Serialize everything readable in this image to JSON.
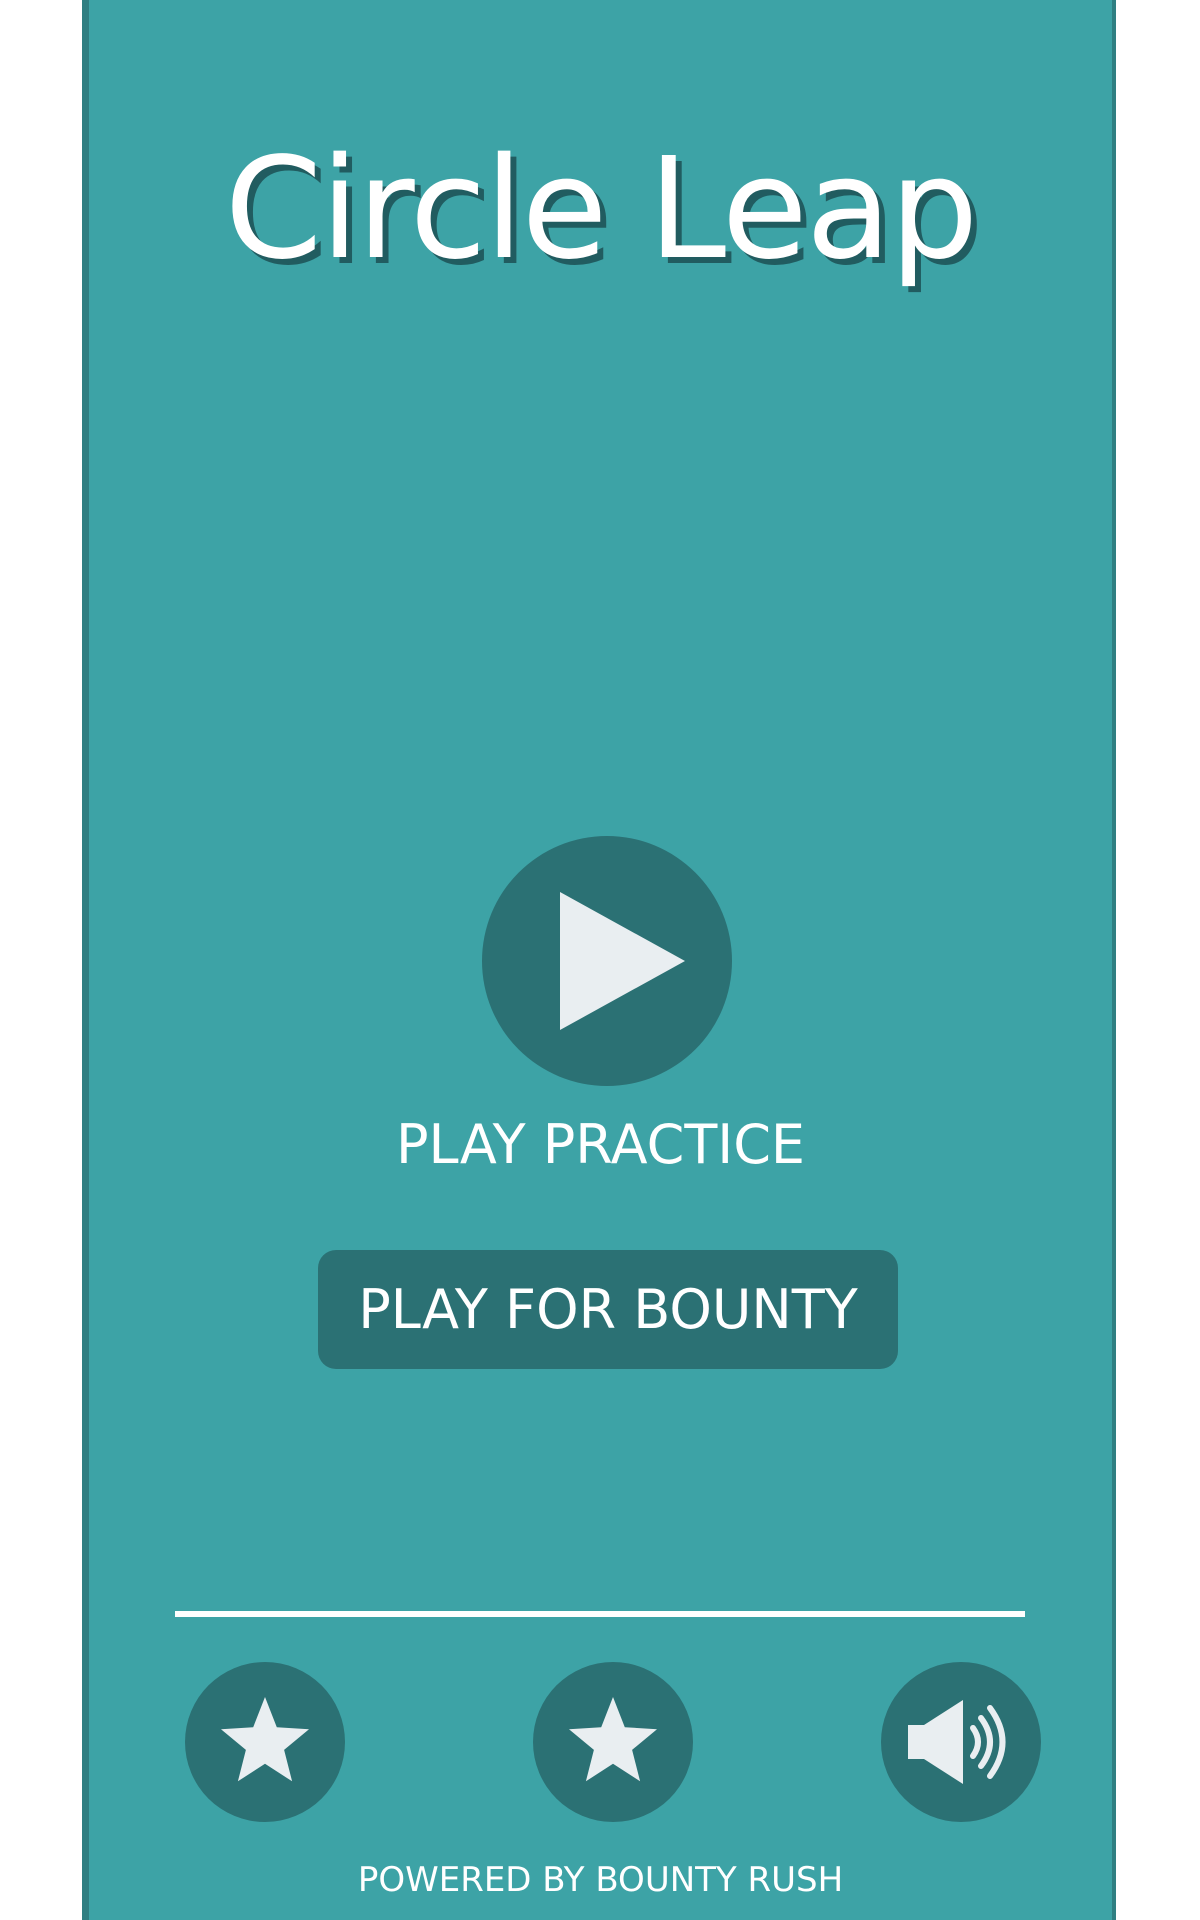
{
  "game": {
    "title": "Circle Leap",
    "play_practice_label": "PLAY PRACTICE",
    "play_bounty_label": "PLAY FOR BOUNTY",
    "footer_text": "POWERED BY BOUNTY RUSH"
  },
  "icons": {
    "play": "play-icon",
    "star_1": "star-icon",
    "star_2": "star-icon",
    "sound": "speaker-icon"
  },
  "colors": {
    "background": "#3da3a6",
    "panel_border": "#2f7f82",
    "button": "#2b7174",
    "text": "#ffffff",
    "icon": "#e9eef1"
  }
}
